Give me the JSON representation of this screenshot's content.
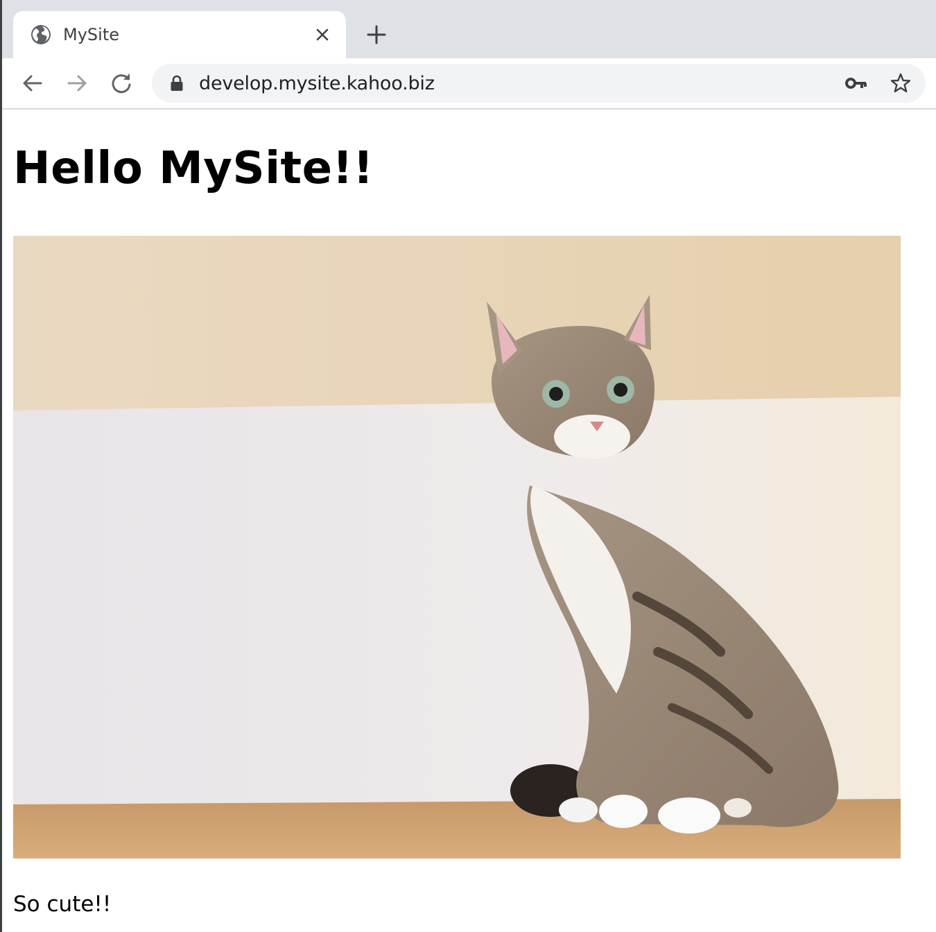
{
  "browser": {
    "tab": {
      "title": "MySite",
      "favicon": "globe-icon"
    },
    "address_bar": {
      "url": "develop.mysite.kahoo.biz"
    },
    "colors": {
      "tabstrip": "#dee1e6",
      "omnibox": "#f1f3f4",
      "icon": "#5f6368",
      "icon_disabled": "#9aa0a6"
    }
  },
  "page": {
    "heading": "Hello MySite!!",
    "image": {
      "subject": "cat-photo"
    },
    "caption": "So cute!!"
  }
}
